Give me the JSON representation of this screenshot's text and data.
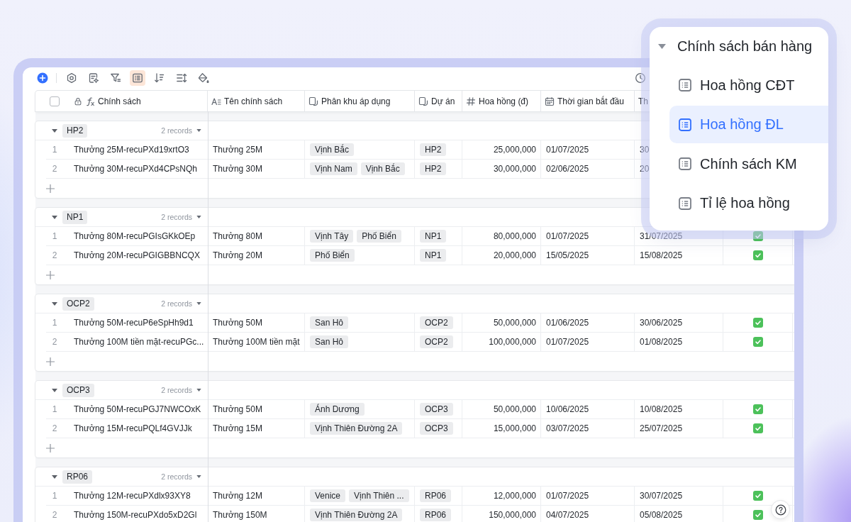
{
  "toolbar": {
    "tools": [
      {
        "selected": false
      },
      {
        "selected": false
      },
      {
        "selected": false
      },
      {
        "selected": false
      },
      {
        "selected": true
      },
      {
        "selected": false
      },
      {
        "selected": false
      },
      {
        "selected": false
      }
    ],
    "right_tools": [
      {
        "selected": false
      }
    ]
  },
  "table": {
    "select_all": {
      "checked": false
    },
    "columns": [
      {
        "label": "Chính sách",
        "kind": "formula",
        "locked": true
      },
      {
        "label": "Tên chính sách",
        "kind": "text"
      },
      {
        "label": "Phân khu áp dụng",
        "kind": "link"
      },
      {
        "label": "Dự án",
        "kind": "link"
      },
      {
        "label": "Hoa hồng (đ)",
        "kind": "number"
      },
      {
        "label": "Thời gian bắt đầu",
        "kind": "date"
      },
      {
        "label": "Th"
      }
    ],
    "groups": [
      {
        "label": "HP2",
        "count": "2 records",
        "expanded": true,
        "rows": [
          {
            "number": "1",
            "name": "Thưởng 25M-recuPXd19xrtO3",
            "title": "Thưởng 25M",
            "zones": [
              "Vịnh Bắc"
            ],
            "project": "HP2",
            "amount": "25,000,000",
            "start": "01/07/2025",
            "end": "30"
          },
          {
            "number": "2",
            "name": "Thưởng 30M-recuPXd4CPsNQh",
            "title": "Thưởng 30M",
            "zones": [
              "Vịnh Nam",
              "Vịnh Bắc"
            ],
            "project": "HP2",
            "amount": "30,000,000",
            "start": "02/06/2025",
            "end": "20"
          }
        ]
      },
      {
        "label": "NP1",
        "count": "2 records",
        "expanded": true,
        "rows": [
          {
            "number": "1",
            "name": "Thưởng 80M-recuPGIsGKkOEp",
            "title": "Thưởng 80M",
            "zones": [
              "Vịnh Tây",
              "Phố Biển"
            ],
            "project": "NP1",
            "amount": "80,000,000",
            "start": "01/07/2025",
            "end": "31/07/2025",
            "checked": true
          },
          {
            "number": "2",
            "name": "Thưởng 20M-recuPGIGBBNCQX",
            "title": "Thưởng 20M",
            "zones": [
              "Phố Biển"
            ],
            "project": "NP1",
            "amount": "20,000,000",
            "start": "15/05/2025",
            "end": "15/08/2025",
            "checked": true
          }
        ]
      },
      {
        "label": "OCP2",
        "count": "2 records",
        "expanded": true,
        "rows": [
          {
            "number": "1",
            "name": "Thưởng 50M-recuP6eSpHh9d1",
            "title": "Thưởng 50M",
            "zones": [
              "San Hô"
            ],
            "project": "OCP2",
            "amount": "50,000,000",
            "start": "01/06/2025",
            "end": "30/06/2025",
            "checked": true
          },
          {
            "number": "2",
            "name": "Thưởng 100M tiền mặt-recuPGc...",
            "title": "Thưởng 100M tiền mặt",
            "zones": [
              "San Hô"
            ],
            "project": "OCP2",
            "amount": "100,000,000",
            "start": "01/07/2025",
            "end": "01/08/2025",
            "checked": true
          }
        ]
      },
      {
        "label": "OCP3",
        "count": "2 records",
        "expanded": true,
        "rows": [
          {
            "number": "1",
            "name": "Thưởng 50M-recuPGJ7NWCOxK",
            "title": "Thưởng 50M",
            "zones": [
              "Ánh Dương"
            ],
            "project": "OCP3",
            "amount": "50,000,000",
            "start": "10/06/2025",
            "end": "10/08/2025",
            "checked": true
          },
          {
            "number": "2",
            "name": "Thưởng 15M-recuPQLf4GVJJk",
            "title": "Thưởng 15M",
            "zones": [
              "Vịnh Thiên Đường 2A"
            ],
            "project": "OCP3",
            "amount": "15,000,000",
            "start": "03/07/2025",
            "end": "25/07/2025",
            "checked": true
          }
        ]
      },
      {
        "label": "RP06",
        "count": "2 records",
        "expanded": true,
        "rows": [
          {
            "number": "1",
            "name": "Thưởng 12M-recuPXdlx93XY8",
            "title": "Thưởng 12M",
            "zones": [
              "Venice",
              "Vịnh Thiên ..."
            ],
            "project": "RP06",
            "amount": "12,000,000",
            "start": "01/07/2025",
            "end": "30/07/2025",
            "checked": true
          },
          {
            "number": "2",
            "name": "Thưởng 150M-recuPXdo5xD2Gl",
            "title": "Thưởng 150M",
            "zones": [
              "Vịnh Thiên Đường 2A"
            ],
            "project": "RP06",
            "amount": "150,000,000",
            "start": "04/07/2025",
            "end": "05/08/2025",
            "checked": true
          }
        ]
      }
    ]
  },
  "popup": {
    "title": "Chính sách bán hàng",
    "expanded": true,
    "items": [
      {
        "label": "Hoa hồng CĐT",
        "selected": false
      },
      {
        "label": "Hoa hồng ĐL",
        "selected": true
      },
      {
        "label": "Chính sách KM",
        "selected": false
      },
      {
        "label": "Tỉ lệ hoa hồng",
        "selected": false
      }
    ]
  }
}
